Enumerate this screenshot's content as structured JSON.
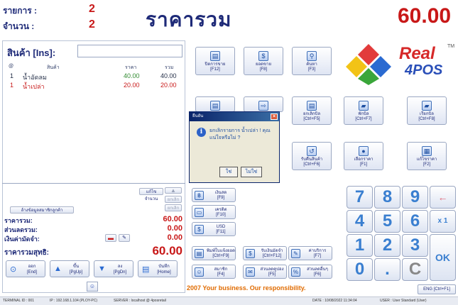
{
  "header": {
    "items_label": "รายการ :",
    "items_value": "2",
    "qty_label": "จำนวน :",
    "qty_value": "2",
    "total_label": "ราคารวม",
    "total_value": "60.00"
  },
  "products": {
    "label": "สินค้า [Ins]:",
    "input_value": "",
    "columns": [
      "@",
      "สินค้า",
      "ราคา",
      "รวม"
    ],
    "rows": [
      {
        "no": "1",
        "name": "น้ำอัดลม",
        "price": "40.00",
        "total": "40.00"
      },
      {
        "no": "1",
        "name": "น้ำเปล่า",
        "price": "20.00",
        "total": "20.00"
      }
    ]
  },
  "side_buttons": {
    "qty": "แก้ไขจำนวน",
    "delete": "ยกเลิก",
    "cancel": "ยกเลิก",
    "member": "ล้างข้อมูลสมาชิกลูกค้า"
  },
  "summary": {
    "total_label": "ราคารวม:",
    "total_value": "60.00",
    "discount_label": "ส่วนลดรวม:",
    "discount_value": "0.00",
    "deposit_label": "เงินค่ามัดจำ:",
    "deposit_value": "0.00",
    "net_label": "ราคารวมสุทธิ:",
    "net_value": "60.00"
  },
  "nav_buttons": [
    {
      "label": "ออก",
      "key": "[End]",
      "icon": "exit-icon"
    },
    {
      "label": "ขึ้น",
      "key": "[PgUp]",
      "icon": "arrow-up-icon"
    },
    {
      "label": "ลง",
      "key": "[PgDn]",
      "icon": "arrow-down-icon"
    },
    {
      "label": "บันทึก",
      "key": "[Home]",
      "icon": "save-icon"
    }
  ],
  "function_buttons": [
    {
      "label": "ปิดการขาย",
      "key": "[F12]"
    },
    {
      "label": "ยอดขาย",
      "key": "[F8]"
    },
    {
      "label": "ค้นหา",
      "key": "[F3]"
    },
    {
      "label": "ยกเลิกบิล",
      "key": "[Ctrl+F5]"
    },
    {
      "label": "พักบิล",
      "key": "[Ctrl+F7]"
    },
    {
      "label": "เรียกบิล",
      "key": "[Ctrl+F8]"
    },
    {
      "label": "รับคืนสินค้า",
      "key": "[Ctrl+F6]"
    },
    {
      "label": "เลือกราคา",
      "key": "[F1]"
    },
    {
      "label": "แก้ไขราคา",
      "key": "[F2]"
    }
  ],
  "small_buttons": [
    {
      "label": "เงินสด",
      "key": "[F9]"
    },
    {
      "label": "เครดิต",
      "key": "[F10]"
    },
    {
      "label": "USD",
      "key": "[F11]"
    },
    {
      "label": "พิมพ์ใบแจ้งยอด",
      "key": "[Ctrl+F9]"
    },
    {
      "label": "รับเงินมัดจำ",
      "key": "[Ctrl+F12]"
    },
    {
      "label": "ค่าบริการ",
      "key": "[F7]"
    },
    {
      "label": "สมาชิก",
      "key": "[F4]"
    },
    {
      "label": "ส่วนลดคูปอง",
      "key": "[F5]"
    },
    {
      "label": "ส่วนลดอื่นๆ",
      "key": "[F6]"
    }
  ],
  "keypad": [
    "7",
    "8",
    "9",
    "←",
    "4",
    "5",
    "6",
    "x 1",
    "1",
    "2",
    "3",
    "OK",
    "0",
    ".",
    "C"
  ],
  "logo": {
    "line1": "Real",
    "line2": "4POS",
    "tm": "TM"
  },
  "dialog": {
    "title": "ยืนยัน",
    "message": "ยกเลิกรายการ น้ำเปล่า ! คุณแน่ใจหรือไม่ ?",
    "yes": "ใช่",
    "no": "ไม่ใช่"
  },
  "slogan": "2007 Your business. Our responsibility.",
  "en_button": "ENG [Ctrl+F1]",
  "status": {
    "terminal": "TERMINAL ID : 001",
    "ip": "IP : 192.168.1.104 (PLOY-PC)",
    "server": "SERVER : localhost @ 4posretail",
    "date": "DATE : 10/08/2022  11:34:04",
    "user": "USER : User Standard (User)"
  },
  "colors": {
    "accent": "#1e2a78",
    "price": "#c81818",
    "keypad": "#3a7fd0",
    "slogan": "#e06b00"
  }
}
